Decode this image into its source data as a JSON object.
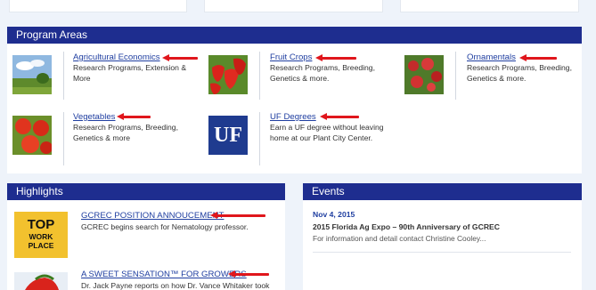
{
  "program_areas": {
    "heading": "Program Areas",
    "items": [
      {
        "title": "Agricultural Economics",
        "desc": "Research Programs, Extension & More",
        "icon": "landscape-photo"
      },
      {
        "title": "Fruit Crops",
        "desc": "Research Programs, Breeding, Genetics & more.",
        "icon": "strawberries-photo"
      },
      {
        "title": "Ornamentals",
        "desc": "Research Programs, Breeding, Genetics & more.",
        "icon": "flowers-photo"
      },
      {
        "title": "Vegetables",
        "desc": "Research Programs, Breeding, Genetics & more",
        "icon": "tomatoes-photo"
      },
      {
        "title": "UF Degrees",
        "desc": "Earn a UF degree without leaving home at our Plant City Center.",
        "logo_text": "UF"
      }
    ]
  },
  "highlights": {
    "heading": "Highlights",
    "items": [
      {
        "title": "GCREC POSITION ANNOUCEMENT",
        "desc": "GCREC begins search for Nematology professor.",
        "badge_line1": "TOP",
        "badge_line2": "WORK",
        "badge_line3": "PLACE"
      },
      {
        "title": "A SWEET SENSATION™ FOR GROWERS",
        "desc": "Dr. Jack Payne reports on how Dr. Vance Whitaker took"
      }
    ]
  },
  "events": {
    "heading": "Events",
    "items": [
      {
        "date": "Nov 4, 2015",
        "title": "2015 Florida Ag Expo – 90th Anniversary of GCREC",
        "desc": "For information and detail contact Christine Cooley..."
      }
    ]
  },
  "colors": {
    "header_bar": "#1e2d8f",
    "link": "#1f3ea0",
    "annotation_arrow": "#e0161c",
    "badge": "#f2c12e"
  }
}
